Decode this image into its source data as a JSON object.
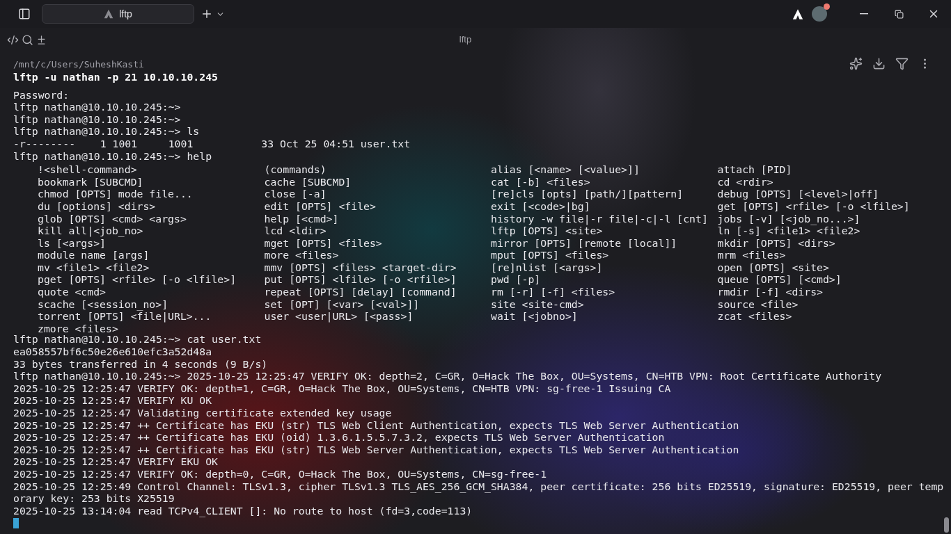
{
  "tabs": [
    {
      "label": "lftp",
      "selected": true
    }
  ],
  "window": {
    "title": "lftp"
  },
  "avatar": {
    "notification": true
  },
  "terminal": {
    "lines": [
      {
        "kind": "path",
        "text": "/mnt/c/Users/SuheshKasti"
      },
      {
        "kind": "command",
        "text": "lftp -u nathan -p 21 10.10.10.245"
      },
      {
        "kind": "blank"
      },
      {
        "kind": "output",
        "text": "Password:"
      },
      {
        "kind": "output",
        "text": "lftp nathan@10.10.10.245:~>"
      },
      {
        "kind": "output",
        "text": "lftp nathan@10.10.10.245:~>"
      },
      {
        "kind": "output",
        "text": "lftp nathan@10.10.10.245:~> ls"
      },
      {
        "kind": "output",
        "text": "-r--------    1 1001     1001           33 Oct 25 04:51 user.txt"
      },
      {
        "kind": "output",
        "text": "lftp nathan@10.10.10.245:~> help"
      },
      {
        "kind": "help",
        "columns": [
          "!<shell-command>",
          "(commands)",
          "alias [<name> [<value>]]",
          "attach [PID]"
        ]
      },
      {
        "kind": "help",
        "columns": [
          "bookmark [SUBCMD]",
          "cache [SUBCMD]",
          "cat [-b] <files>",
          "cd <rdir>"
        ]
      },
      {
        "kind": "help",
        "columns": [
          "chmod [OPTS] mode file...",
          "close [-a]",
          "[re]cls [opts] [path/][pattern]",
          "debug [OPTS] [<level>|off]"
        ]
      },
      {
        "kind": "help",
        "columns": [
          "du [options] <dirs>",
          "edit [OPTS] <file>",
          "exit [<code>|bg]",
          "get [OPTS] <rfile> [-o <lfile>]"
        ]
      },
      {
        "kind": "help",
        "columns": [
          "glob [OPTS] <cmd> <args>",
          "help [<cmd>]",
          "history -w file|-r file|-c|-l [cnt]",
          "jobs [-v] [<job_no...>]"
        ]
      },
      {
        "kind": "help",
        "columns": [
          "kill all|<job_no>",
          "lcd <ldir>",
          "lftp [OPTS] <site>",
          "ln [-s] <file1> <file2>"
        ]
      },
      {
        "kind": "help",
        "columns": [
          "ls [<args>]",
          "mget [OPTS] <files>",
          "mirror [OPTS] [remote [local]]",
          "mkdir [OPTS] <dirs>"
        ]
      },
      {
        "kind": "help",
        "columns": [
          "module name [args]",
          "more <files>",
          "mput [OPTS] <files>",
          "mrm <files>"
        ]
      },
      {
        "kind": "help",
        "columns": [
          "mv <file1> <file2>",
          "mmv [OPTS] <files> <target-dir>",
          "[re]nlist [<args>]",
          "open [OPTS] <site>"
        ]
      },
      {
        "kind": "help",
        "columns": [
          "pget [OPTS] <rfile> [-o <lfile>]",
          "put [OPTS] <lfile> [-o <rfile>]",
          "pwd [-p]",
          "queue [OPTS] [<cmd>]"
        ]
      },
      {
        "kind": "help",
        "columns": [
          "quote <cmd>",
          "repeat [OPTS] [delay] [command]",
          "rm [-r] [-f] <files>",
          "rmdir [-f] <dirs>"
        ]
      },
      {
        "kind": "help",
        "columns": [
          "scache [<session_no>]",
          "set [OPT] [<var> [<val>]]",
          "site <site-cmd>",
          "source <file>"
        ]
      },
      {
        "kind": "help",
        "columns": [
          "torrent [OPTS] <file|URL>...",
          "user <user|URL> [<pass>]",
          "wait [<jobno>]",
          "zcat <files>"
        ]
      },
      {
        "kind": "help",
        "columns": [
          "zmore <files>"
        ]
      },
      {
        "kind": "output",
        "text": "lftp nathan@10.10.10.245:~> cat user.txt"
      },
      {
        "kind": "output",
        "text": "ea058557bf6c50e26e610efc3a52d48a"
      },
      {
        "kind": "output",
        "text": "33 bytes transferred in 4 seconds (9 B/s)"
      },
      {
        "kind": "output",
        "text": "lftp nathan@10.10.10.245:~> 2025-10-25 12:25:47 VERIFY OK: depth=2, C=GR, O=Hack The Box, OU=Systems, CN=HTB VPN: Root Certificate Authority"
      },
      {
        "kind": "output",
        "text": "2025-10-25 12:25:47 VERIFY OK: depth=1, C=GR, O=Hack The Box, OU=Systems, CN=HTB VPN: sg-free-1 Issuing CA"
      },
      {
        "kind": "output",
        "text": "2025-10-25 12:25:47 VERIFY KU OK"
      },
      {
        "kind": "output",
        "text": "2025-10-25 12:25:47 Validating certificate extended key usage"
      },
      {
        "kind": "output",
        "text": "2025-10-25 12:25:47 ++ Certificate has EKU (str) TLS Web Client Authentication, expects TLS Web Server Authentication"
      },
      {
        "kind": "output",
        "text": "2025-10-25 12:25:47 ++ Certificate has EKU (oid) 1.3.6.1.5.5.7.3.2, expects TLS Web Server Authentication"
      },
      {
        "kind": "output",
        "text": "2025-10-25 12:25:47 ++ Certificate has EKU (str) TLS Web Server Authentication, expects TLS Web Server Authentication"
      },
      {
        "kind": "output",
        "text": "2025-10-25 12:25:47 VERIFY EKU OK"
      },
      {
        "kind": "output",
        "text": "2025-10-25 12:25:47 VERIFY OK: depth=0, C=GR, O=Hack The Box, OU=Systems, CN=sg-free-1"
      },
      {
        "kind": "output",
        "text": "2025-10-25 12:25:49 Control Channel: TLSv1.3, cipher TLSv1.3 TLS_AES_256_GCM_SHA384, peer certificate: 256 bits ED25519, signature: ED25519, peer temp"
      },
      {
        "kind": "output",
        "text": "orary key: 253 bits X25519"
      },
      {
        "kind": "output",
        "text": "2025-10-25 13:14:04 read TCPv4_CLIENT []: No route to host (fd=3,code=113)"
      },
      {
        "kind": "cursor"
      }
    ]
  }
}
